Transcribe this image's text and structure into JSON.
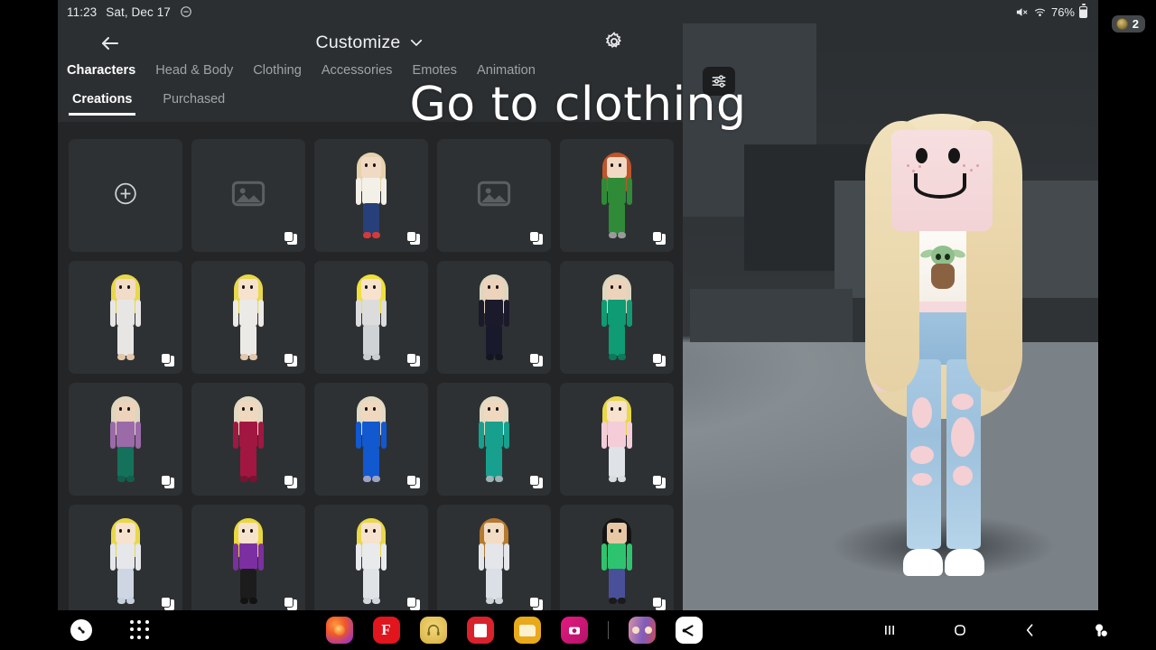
{
  "status_bar": {
    "time": "11:23",
    "date": "Sat, Dec 17",
    "dnd_icon": "do-not-disturb-icon",
    "mute_icon": "volume-muted-icon",
    "wifi_icon": "wifi-icon",
    "battery_percent": "76%",
    "battery_icon": "battery-icon"
  },
  "coin_badge": {
    "icon": "robux-coin-icon",
    "count": "2"
  },
  "header": {
    "back_icon": "back-arrow-icon",
    "title": "Customize",
    "chevron_icon": "chevron-down-icon",
    "settings_icon": "gear-icon"
  },
  "tabs": [
    {
      "label": "Characters",
      "active": true
    },
    {
      "label": "Head & Body",
      "active": false
    },
    {
      "label": "Clothing",
      "active": false
    },
    {
      "label": "Accessories",
      "active": false
    },
    {
      "label": "Emotes",
      "active": false
    },
    {
      "label": "Animation",
      "active": false
    }
  ],
  "subtabs": [
    {
      "label": "Creations",
      "active": true
    },
    {
      "label": "Purchased",
      "active": false
    }
  ],
  "filter_button": {
    "icon": "filter-sliders-icon"
  },
  "caption": {
    "text": "Go to clothing"
  },
  "grid": {
    "cells": [
      {
        "kind": "add",
        "icon": "plus-circle-icon",
        "label": "Create new character"
      },
      {
        "kind": "placeholder",
        "icon": "image-placeholder-icon",
        "badge": "duplicate-icon"
      },
      {
        "kind": "avatar",
        "badge": "duplicate-icon",
        "hair": "#e6d3ac",
        "skin": "#f2d9c4",
        "top": "#f3f0e8",
        "legs": "#27407a",
        "shoes": "#d13b3b",
        "label": "Character with white tee and jeans"
      },
      {
        "kind": "placeholder",
        "icon": "image-placeholder-icon",
        "badge": "duplicate-icon"
      },
      {
        "kind": "avatar",
        "badge": "duplicate-icon",
        "hair": "#c0542a",
        "skin": "#f2d9c4",
        "top": "#2f8b37",
        "legs": "#2f8b37",
        "shoes": "#9a9a9a",
        "label": "Character in green outfit with pigtails"
      },
      {
        "kind": "avatar",
        "badge": "duplicate-icon",
        "hair": "#e8d84a",
        "skin": "#f2dcc7",
        "top": "#e7e6e4",
        "legs": "#e7e6e4",
        "shoes": "#e3c7ab",
        "label": "Character in white dress"
      },
      {
        "kind": "avatar",
        "badge": "duplicate-icon",
        "hair": "#e8d84a",
        "skin": "#f6e2cd",
        "top": "#eceae6",
        "legs": "#eceae6",
        "shoes": "#e3c7ab",
        "label": "Character in white dress"
      },
      {
        "kind": "avatar",
        "badge": "duplicate-icon",
        "hair": "#efe03a",
        "skin": "#f6e2cd",
        "top": "#dcdcdc",
        "legs": "#cfd3d6",
        "shoes": "#c9cdd0",
        "label": "Character in silver dress"
      },
      {
        "kind": "avatar",
        "badge": "duplicate-icon",
        "hair": "#dfd6c0",
        "skin": "#edd3bb",
        "top": "#1a1a2b",
        "legs": "#181a2c",
        "shoes": "#14151f",
        "label": "Character in black outfit"
      },
      {
        "kind": "avatar",
        "badge": "duplicate-icon",
        "hair": "#dfd6c0",
        "skin": "#edd3bb",
        "top": "#0f9b74",
        "legs": "#0f9b74",
        "shoes": "#0c7a5c",
        "label": "Character in teal green dress"
      },
      {
        "kind": "avatar",
        "badge": "duplicate-icon",
        "hair": "#dfd6c0",
        "skin": "#edd3bb",
        "top": "#9b6aa8",
        "legs": "#14725c",
        "shoes": "#11604d",
        "label": "Character in purple top and green pants"
      },
      {
        "kind": "avatar",
        "badge": "duplicate-icon",
        "hair": "#e2dac4",
        "skin": "#f0d8bf",
        "top": "#a21741",
        "legs": "#a21741",
        "shoes": "#7e1133",
        "label": "Character in deep red gown"
      },
      {
        "kind": "avatar",
        "badge": "duplicate-icon",
        "hair": "#e2dac4",
        "skin": "#f0d8bf",
        "top": "#1258cf",
        "legs": "#1258cf",
        "shoes": "#9aa3c6",
        "label": "Character in blue tracksuit"
      },
      {
        "kind": "avatar",
        "badge": "duplicate-icon",
        "hair": "#e2dac4",
        "skin": "#f0d8bf",
        "top": "#17a08d",
        "legs": "#17a08d",
        "shoes": "#9bb3b7",
        "label": "Character in teal gown"
      },
      {
        "kind": "avatar",
        "badge": "duplicate-icon",
        "hair": "#e8d84a",
        "skin": "#f6e2cd",
        "top": "#f5cdd9",
        "legs": "#dfe2e6",
        "shoes": "#d9dde0",
        "label": "Character in pink top and white pants"
      },
      {
        "kind": "avatar",
        "badge": "duplicate-icon",
        "hair": "#e8d84a",
        "skin": "#f6e2cd",
        "top": "#e5e7ea",
        "legs": "#cdd6e2",
        "shoes": "#c6d0dc",
        "label": "Character in white off-shoulder top"
      },
      {
        "kind": "avatar",
        "badge": "duplicate-icon",
        "hair": "#ead83c",
        "skin": "#f6e2cd",
        "top": "#7b2fa0",
        "legs": "#1c1c1c",
        "shoes": "#121212",
        "label": "Character in purple top and black boots"
      },
      {
        "kind": "avatar",
        "badge": "duplicate-icon",
        "hair": "#e8d84a",
        "skin": "#f6e2cd",
        "top": "#e8eaec",
        "legs": "#e0e3e6",
        "shoes": "#d4d8dc",
        "label": "Character in all white outfit"
      },
      {
        "kind": "avatar",
        "badge": "duplicate-icon",
        "hair": "#b5792f",
        "skin": "#f3dcc4",
        "top": "#e4e6e9",
        "legs": "#dbe0e6",
        "shoes": "#cdd3da",
        "label": "Character with brown hair in white outfit"
      },
      {
        "kind": "avatar",
        "badge": "duplicate-icon",
        "hair": "#141414",
        "skin": "#e8c8a4",
        "top": "#2ec46f",
        "legs": "#4a4f9a",
        "shoes": "#1b1b1b",
        "label": "Character with black hair and green top"
      }
    ]
  },
  "avatar_preview": {
    "label": "character-3d-preview",
    "hair_color": "#ead9b4",
    "skin_color": "#f6dfe1",
    "shirt_color": "#fdfbf7",
    "shirt_graphic": "grogu-icon",
    "pants_color": "#9fc3df",
    "shoes_color": "#ffffff"
  },
  "bottom_bar": {
    "left": [
      {
        "icon": "accessibility-assistant-icon",
        "label": "Assistant"
      },
      {
        "icon": "app-drawer-icon",
        "label": "Apps"
      }
    ],
    "dock": [
      {
        "icon": "firefox-icon",
        "label": "Firefox"
      },
      {
        "icon": "flipboard-icon",
        "label": "Flipboard"
      },
      {
        "icon": "headphones-icon",
        "label": "Audio"
      },
      {
        "icon": "sticky-note-icon",
        "label": "Notes"
      },
      {
        "icon": "files-folder-icon",
        "label": "My Files"
      },
      {
        "icon": "camera-app-icon",
        "label": "Camera"
      },
      {
        "icon": "divider",
        "label": "divider"
      },
      {
        "icon": "photo-collage-icon",
        "label": "Gallery"
      },
      {
        "icon": "capcut-icon",
        "label": "CapCut"
      }
    ],
    "nav": [
      {
        "icon": "recents-icon",
        "label": "Recents"
      },
      {
        "icon": "home-icon",
        "label": "Home"
      },
      {
        "icon": "back-icon",
        "label": "Back"
      },
      {
        "icon": "screen-record-icon",
        "label": "Screen recorder"
      }
    ]
  }
}
